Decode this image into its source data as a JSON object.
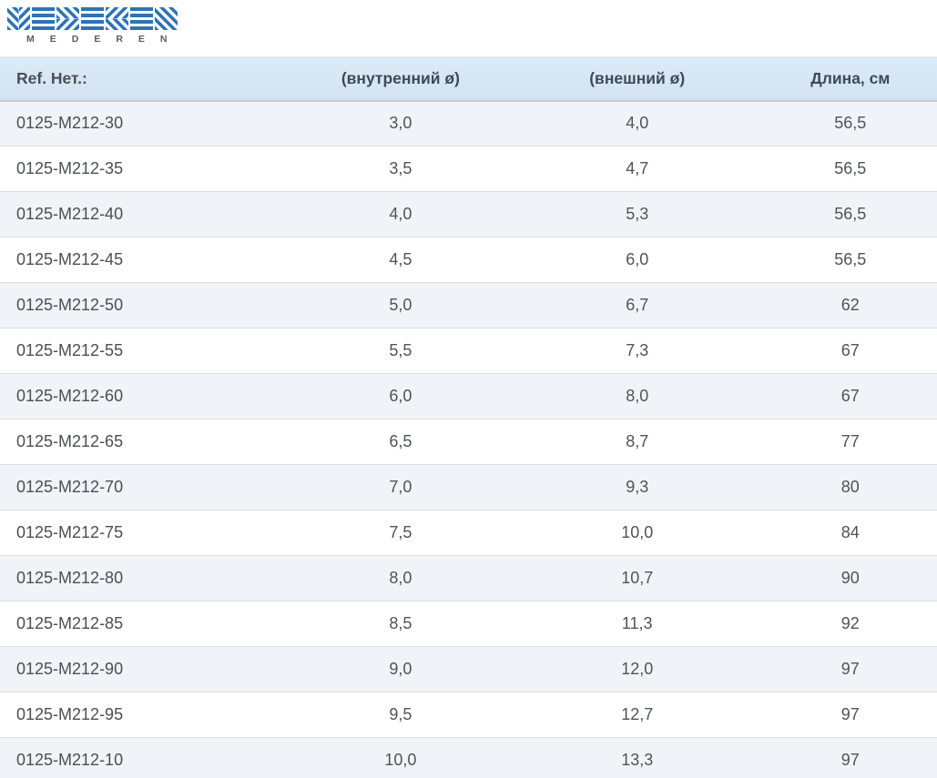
{
  "logo": {
    "brand": "MEDEREN",
    "tile_color": "#2e73b5",
    "tiles": [
      {
        "letter": "M",
        "pattern": "chevron-down"
      },
      {
        "letter": "E",
        "pattern": "horizontal-stripes"
      },
      {
        "letter": "D",
        "pattern": "chevron-right"
      },
      {
        "letter": "E",
        "pattern": "horizontal-stripes"
      },
      {
        "letter": "R",
        "pattern": "chevron-left"
      },
      {
        "letter": "E",
        "pattern": "horizontal-stripes"
      },
      {
        "letter": "N",
        "pattern": "diagonal-stripes"
      }
    ]
  },
  "table": {
    "columns": [
      "Ref. Нет.:",
      "(внутренний ø)",
      "(внешний ø)",
      "Длина, см"
    ],
    "rows": [
      [
        "0125-M212-30",
        "3,0",
        "4,0",
        "56,5"
      ],
      [
        "0125-M212-35",
        "3,5",
        "4,7",
        "56,5"
      ],
      [
        "0125-M212-40",
        "4,0",
        "5,3",
        "56,5"
      ],
      [
        "0125-M212-45",
        "4,5",
        "6,0",
        "56,5"
      ],
      [
        "0125-M212-50",
        "5,0",
        "6,7",
        "62"
      ],
      [
        "0125-M212-55",
        "5,5",
        "7,3",
        "67"
      ],
      [
        "0125-M212-60",
        "6,0",
        "8,0",
        "67"
      ],
      [
        "0125-M212-65",
        "6,5",
        "8,7",
        "77"
      ],
      [
        "0125-M212-70",
        "7,0",
        "9,3",
        "80"
      ],
      [
        "0125-M212-75",
        "7,5",
        "10,0",
        "84"
      ],
      [
        "0125-M212-80",
        "8,0",
        "10,7",
        "90"
      ],
      [
        "0125-M212-85",
        "8,5",
        "11,3",
        "92"
      ],
      [
        "0125-M212-90",
        "9,0",
        "12,0",
        "97"
      ],
      [
        "0125-M212-95",
        "9,5",
        "12,7",
        "97"
      ],
      [
        "0125-M212-10",
        "10,0",
        "13,3",
        "97"
      ]
    ]
  },
  "colors": {
    "logo_blue": "#2e73b5",
    "header_background_top": "#dcebf8",
    "header_background_bottom": "#d2e2f1",
    "header_text": "#3d4a57",
    "cell_text": "#4e545a",
    "shaded_row": "#f0f4f8"
  }
}
